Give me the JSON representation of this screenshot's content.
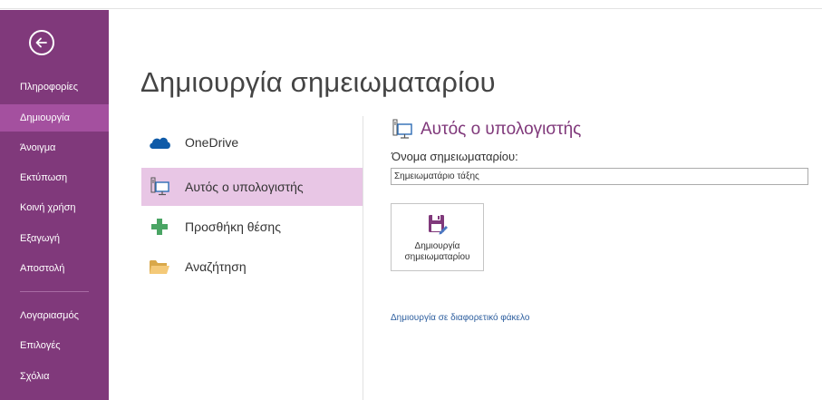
{
  "sidebar": {
    "items": [
      {
        "label": "Πληροφορίες",
        "active": false
      },
      {
        "label": "Δημιουργία",
        "active": true
      },
      {
        "label": "Άνοιγμα",
        "active": false
      },
      {
        "label": "Εκτύπωση",
        "active": false
      },
      {
        "label": "Κοινή χρήση",
        "active": false
      },
      {
        "label": "Εξαγωγή",
        "active": false
      },
      {
        "label": "Αποστολή",
        "active": false
      },
      {
        "label": "Λογαριασμός",
        "active": false
      },
      {
        "label": "Επιλογές",
        "active": false
      },
      {
        "label": "Σχόλια",
        "active": false
      }
    ],
    "back_icon": "back-arrow-icon",
    "color": "#80397b",
    "active_color": "#a4509f"
  },
  "page": {
    "title": "Δημιουργία σημειωματαρίου"
  },
  "locations": [
    {
      "label": "OneDrive",
      "icon": "onedrive-cloud-icon",
      "selected": false
    },
    {
      "label": "Αυτός ο υπολογιστής",
      "icon": "this-pc-icon",
      "selected": true
    },
    {
      "label": "Προσθήκη θέσης",
      "icon": "add-place-icon",
      "selected": false
    },
    {
      "label": "Αναζήτηση",
      "icon": "folder-browse-icon",
      "selected": false
    }
  ],
  "right_panel": {
    "header": "Αυτός ο υπολογιστής",
    "name_label": "Όνομα σημειωματαρίου:",
    "name_value": "Σημειωματάριο τάξης",
    "create_button_label": "Δημιουργία\nσημειωματαρίου",
    "other_folder_link": "Δημιουργία σε διαφορετικό φάκελο"
  },
  "colors": {
    "accent": "#80397b",
    "selected_bg": "#e8c6e5",
    "link": "#2d5e9e"
  }
}
